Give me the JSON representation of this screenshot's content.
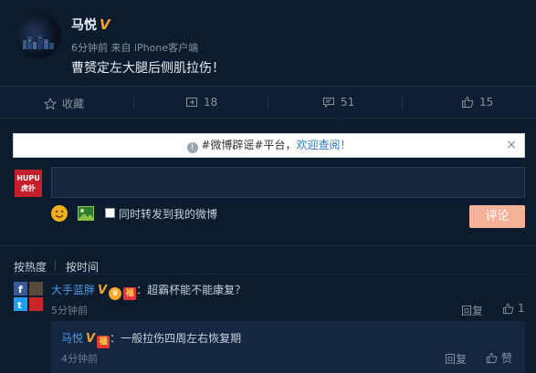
{
  "post": {
    "author": "马悦",
    "verified_mark": "V",
    "time": "6分钟前",
    "source": "来自 iPhone客户端",
    "content": "曹赟定左大腿后侧肌拉伤！"
  },
  "actions": {
    "favorite_label": "收藏",
    "repost_count": "18",
    "comment_count": "51",
    "like_count": "15"
  },
  "banner": {
    "prefix": "#微博辟谣#平台，",
    "link": "欢迎查阅！",
    "close": "×"
  },
  "composer": {
    "hupu_line1": "HUPU",
    "hupu_line2": "虎扑",
    "repost_checkbox_label": "同时转发到我的微博",
    "submit_label": "评论"
  },
  "sort": {
    "by_hot": "按热度",
    "by_time": "按时间"
  },
  "comments": [
    {
      "author": "大手蓝胖",
      "verified_mark": "V",
      "text": "：超霸杯能不能康复？",
      "time": "5分钟前",
      "reply_label": "回复",
      "like_count": "1"
    }
  ],
  "nested_reply": {
    "author": "马悦",
    "verified_mark": "V",
    "text": "：一般拉伤四周左右恢复期",
    "time": "4分钟前",
    "reply_label": "回复",
    "like_label": "赞"
  },
  "colors": {
    "background": "#0d1b2e",
    "accent_link": "#4d9be6",
    "verified": "#f5a623",
    "submit": "#f4b399"
  }
}
